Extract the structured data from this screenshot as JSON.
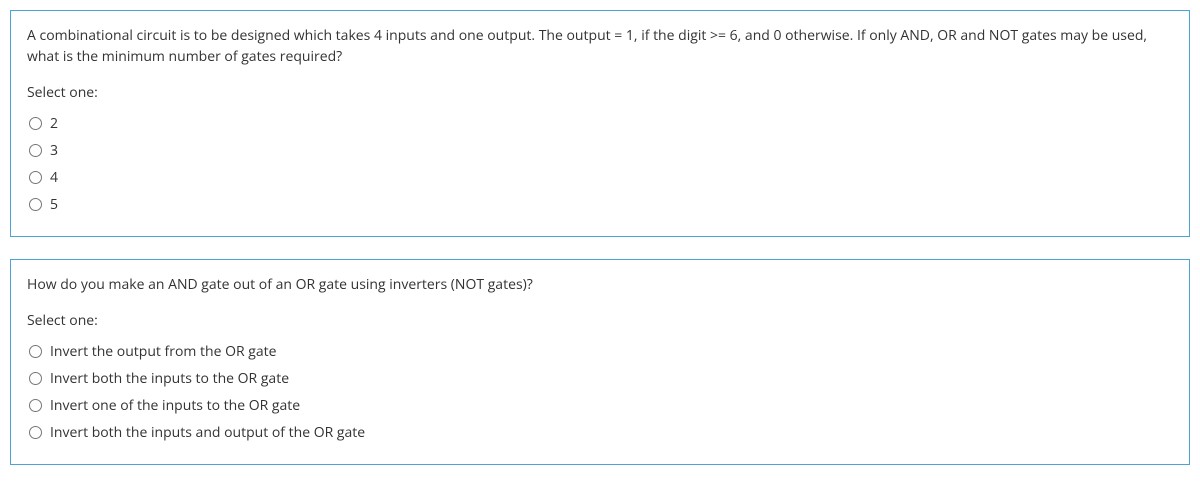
{
  "questions": [
    {
      "text": "A combinational circuit is to be designed which takes 4 inputs and one output. The output = 1, if the digit >= 6, and 0 otherwise. If only AND, OR and NOT gates may be used, what is the minimum number of gates required?",
      "select_label": "Select one:",
      "options": [
        "2",
        "3",
        "4",
        "5"
      ]
    },
    {
      "text": "How do you make an AND gate out of an OR gate using inverters (NOT gates)?",
      "select_label": "Select one:",
      "options": [
        "Invert the output from the OR gate",
        "Invert both the inputs to the OR gate",
        "Invert one of the inputs to the OR gate",
        "Invert both the inputs and output of the OR gate"
      ]
    }
  ]
}
